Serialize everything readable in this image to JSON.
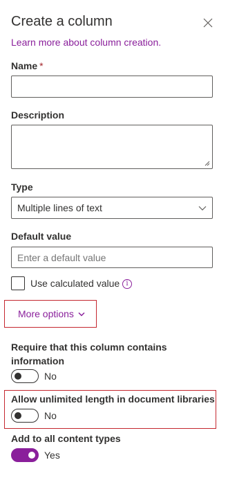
{
  "panel": {
    "title": "Create a column",
    "learn_more": "Learn more about column creation."
  },
  "name_field": {
    "label": "Name",
    "required_marker": "*",
    "value": ""
  },
  "description_field": {
    "label": "Description",
    "value": ""
  },
  "type_field": {
    "label": "Type",
    "selected": "Multiple lines of text"
  },
  "default_field": {
    "label": "Default value",
    "placeholder": "Enter a default value"
  },
  "calculated": {
    "label": "Use calculated value",
    "checked": false
  },
  "more_options": {
    "label": "More options"
  },
  "require": {
    "label": "Require that this column contains information",
    "state_text": "No",
    "on": false
  },
  "unlimited": {
    "label": "Allow unlimited length in document libraries",
    "state_text": "No",
    "on": false
  },
  "content_types": {
    "label": "Add to all content types",
    "state_text": "Yes",
    "on": true
  },
  "colors": {
    "accent": "#8a1f9b",
    "highlight_border": "#c4262e",
    "text": "#323130"
  },
  "icons": [
    "close-icon",
    "chevron-down-icon",
    "info-icon",
    "resize-grip-icon"
  ]
}
